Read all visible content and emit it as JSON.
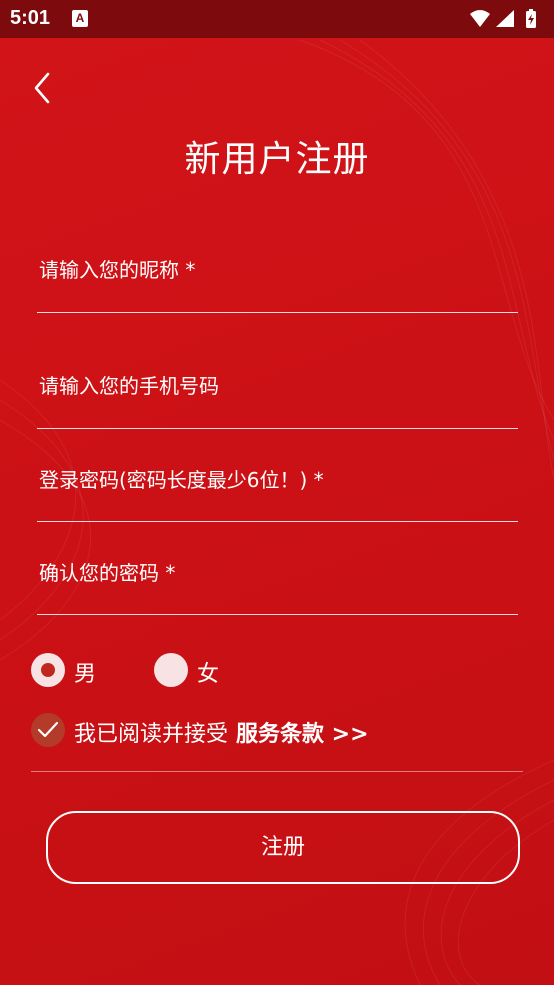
{
  "status_bar": {
    "time": "5:01",
    "notification_icon": "A"
  },
  "header": {
    "back_icon": "chevron-left-icon",
    "title": "新用户注册"
  },
  "form": {
    "nickname_placeholder": "请输入您的昵称 *",
    "phone_placeholder": "请输入您的手机号码",
    "password_placeholder": "登录密码(密码长度最少6位！) *",
    "confirm_password_placeholder": "确认您的密码 *"
  },
  "gender": {
    "selected": "male",
    "options": [
      {
        "key": "male",
        "label": "男"
      },
      {
        "key": "female",
        "label": "女"
      }
    ]
  },
  "agreement": {
    "checked": true,
    "text": "我已阅读并接受",
    "terms_link": "服务条款 >>"
  },
  "register_button_label": "注册",
  "colors": {
    "background": "#cc1116",
    "status_bar": "#7d0a0c",
    "radio_fill": "#f7e3e3",
    "radio_selected_dot": "#c0281f",
    "checkbox_fill": "#b43a2a"
  }
}
